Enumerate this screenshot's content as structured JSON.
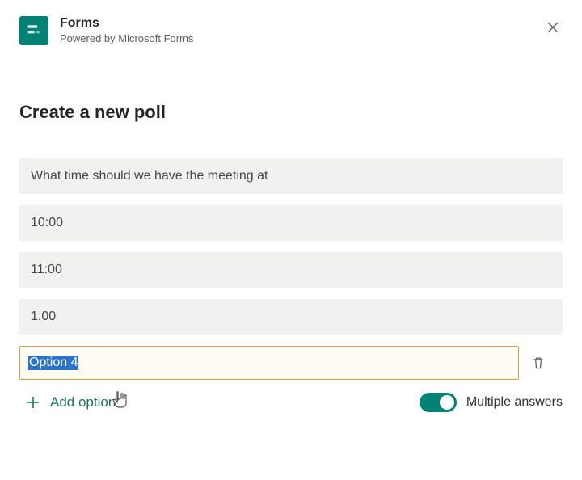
{
  "header": {
    "title": "Forms",
    "subtitle": "Powered by Microsoft Forms"
  },
  "heading": "Create a new poll",
  "question": "What time should we have the meeting at",
  "options": [
    "10:00",
    "11:00",
    "1:00"
  ],
  "editing_option": "Option 4",
  "add_option_label": "Add option",
  "toggle_label": "Multiple answers",
  "toggle_on": true
}
